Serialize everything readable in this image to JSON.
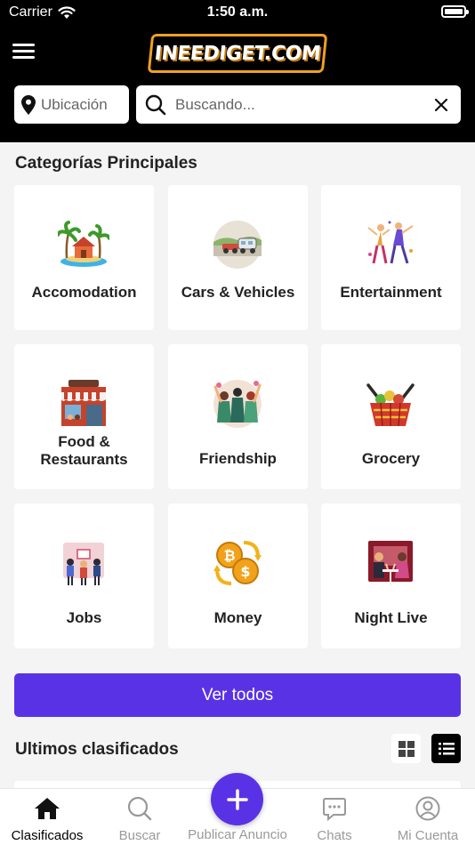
{
  "status_bar": {
    "carrier": "Carrier",
    "time": "1:50 a.m."
  },
  "header": {
    "logo_text": "INEEDIGET.COM",
    "location_label": "Ubicación",
    "search_placeholder": "Buscando...",
    "search_value": ""
  },
  "categories_section": {
    "title": "Categorías Principales"
  },
  "categories": [
    {
      "label": "Accomodation",
      "icon": "beach-house-icon"
    },
    {
      "label": "Cars & Vehicles",
      "icon": "car-trailer-icon"
    },
    {
      "label": "Entertainment",
      "icon": "dancers-icon"
    },
    {
      "label": "Food & Restaurants",
      "icon": "coffee-shop-icon"
    },
    {
      "label": "Friendship",
      "icon": "friends-group-icon"
    },
    {
      "label": "Grocery",
      "icon": "grocery-basket-icon"
    },
    {
      "label": "Jobs",
      "icon": "workers-icon"
    },
    {
      "label": "Money",
      "icon": "coins-exchange-icon"
    },
    {
      "label": "Night Live",
      "icon": "nightlife-couple-icon"
    }
  ],
  "see_all_label": "Ver todos",
  "latest_section": {
    "title": "Ultimos clasificados",
    "view_mode": "list"
  },
  "bottom_nav": {
    "items": [
      {
        "label": "Clasificados",
        "icon": "home-icon",
        "active": true
      },
      {
        "label": "Buscar",
        "icon": "search-icon",
        "active": false
      },
      {
        "label": "Publicar Anuncio",
        "icon": "plus-icon",
        "active": false
      },
      {
        "label": "Chats",
        "icon": "chat-bubble-icon",
        "active": false
      },
      {
        "label": "Mi Cuenta",
        "icon": "user-circle-icon",
        "active": false
      }
    ]
  },
  "colors": {
    "accent": "#5a32e6",
    "header_bg": "#000000",
    "logo_border": "#f0a020",
    "page_bg": "#f4f4f4"
  }
}
